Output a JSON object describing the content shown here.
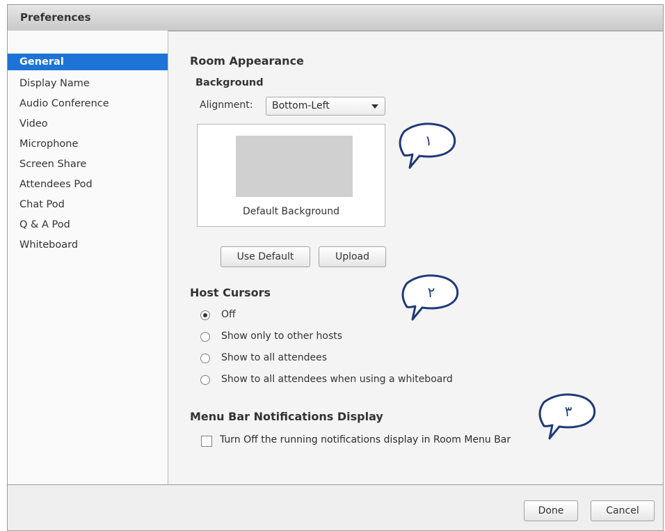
{
  "window": {
    "title": "Preferences"
  },
  "sidebar": {
    "items": [
      {
        "label": "General",
        "active": true
      },
      {
        "label": "Display Name"
      },
      {
        "label": "Audio Conference"
      },
      {
        "label": "Video"
      },
      {
        "label": "Microphone"
      },
      {
        "label": "Screen Share"
      },
      {
        "label": "Attendees Pod"
      },
      {
        "label": "Chat Pod"
      },
      {
        "label": "Q & A Pod"
      },
      {
        "label": "Whiteboard"
      }
    ]
  },
  "room_appearance": {
    "heading": "Room Appearance",
    "background": {
      "heading": "Background",
      "alignment_label": "Alignment:",
      "alignment_value": "Bottom-Left",
      "preview_caption": "Default Background",
      "use_default_label": "Use Default",
      "upload_label": "Upload"
    }
  },
  "host_cursors": {
    "heading": "Host Cursors",
    "options": [
      {
        "label": "Off",
        "selected": true
      },
      {
        "label": "Show only to other hosts",
        "selected": false
      },
      {
        "label": "Show to all attendees",
        "selected": false
      },
      {
        "label": "Show to all attendees when using a whiteboard",
        "selected": false
      }
    ]
  },
  "menu_bar": {
    "heading": "Menu Bar Notifications Display",
    "checkbox_label": "Turn Off the running notifications display in Room Menu Bar",
    "checked": false
  },
  "footer": {
    "done_label": "Done",
    "cancel_label": "Cancel"
  },
  "annotations": [
    "١",
    "٢",
    "٣"
  ],
  "colors": {
    "selection": "#1e74d6",
    "bubble_stroke": "#1f3a78"
  }
}
